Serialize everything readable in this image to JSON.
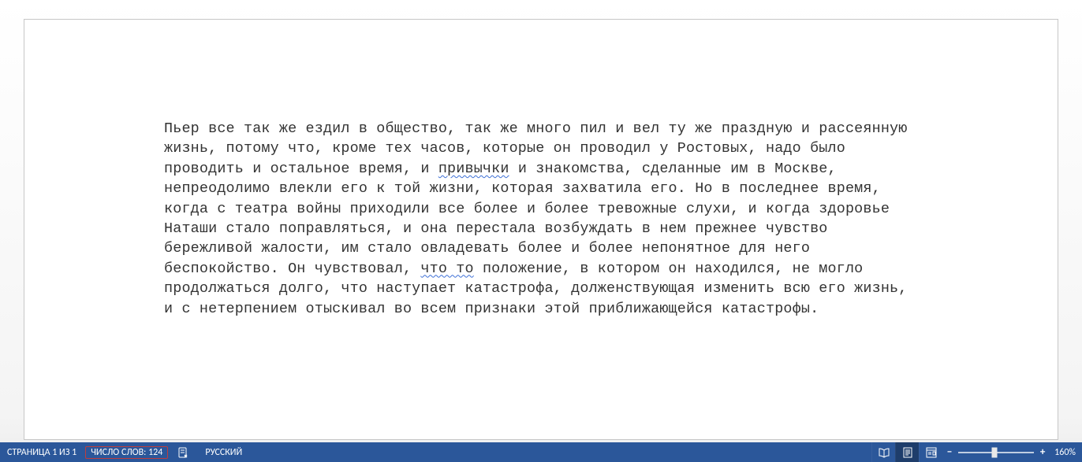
{
  "document": {
    "text_pre1": "Пьер все так же ездил в общество, так же много пил и вел ту же праздную и рассеянную жизнь, потому что, кроме тех часов, которые он проводил у Ростовых, надо было проводить и остальное время, и ",
    "wavy1": "привычки",
    "text_mid1": " и знакомства, сделанные им в Москве, непреодолимо влекли его к той жизни, которая захватила его. Но в последнее время, когда с театра войны приходили все более и более тревожные слухи, и когда здоровье Наташи стало поправляться, и она перестала возбуждать в нем прежнее чувство бережливой жалости, им стало овладевать более и более непонятное для него беспокойство. Он чувствовал, ",
    "wavy2": "что то",
    "text_post": " положение, в котором он находился, не могло продолжаться долго, что наступает катастрофа, долженствующая изменить всю его жизнь, и с нетерпением отыскивал во всем признаки этой приближающейся катастрофы."
  },
  "statusbar": {
    "page": "СТРАНИЦА 1 ИЗ 1",
    "words": "ЧИСЛО СЛОВ: 124",
    "language": "РУССКИЙ",
    "zoom_minus": "−",
    "zoom_plus": "+",
    "zoom_value": "160%"
  }
}
